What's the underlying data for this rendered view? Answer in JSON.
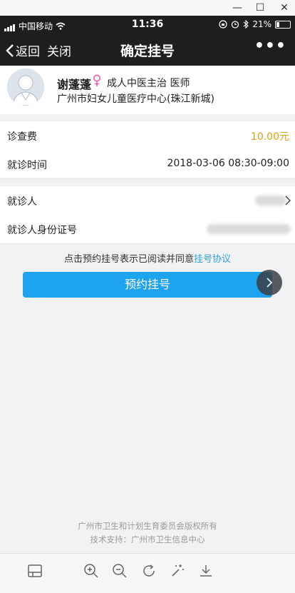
{
  "window_controls": {
    "minimize": "—",
    "maximize": "☐",
    "close": "✕"
  },
  "statusbar": {
    "carrier": "中国移动",
    "time": "11:36",
    "battery": "21%"
  },
  "navbar": {
    "back_label": "返回",
    "close_label": "关闭",
    "title": "确定挂号",
    "more_label": "•••"
  },
  "doctor": {
    "name": "谢蓬蓬",
    "gender_symbol": "♀",
    "title": "成人中医主治  医师",
    "hospital": "广州市妇女儿童医疗中心(珠江新城)"
  },
  "rows": {
    "fee_label": "诊查费",
    "fee_value": "10.00元",
    "time_label": "就诊时间",
    "time_value": "2018-03-06    08:30-09:00",
    "patient_label": "就诊人",
    "patient_id_label": "就诊人身份证号"
  },
  "agreement": {
    "prefix": "点击预约挂号表示已阅读并同意",
    "link": "挂号协议"
  },
  "button": {
    "label": "预约挂号"
  },
  "footer": {
    "line1": "广州市卫生和计划生育委员会版权所有",
    "line2": "技术支持：广州市卫生信息中心"
  },
  "colors": {
    "accent": "#1ea3ee",
    "fee": "#d9a214",
    "link": "#2fa3d7",
    "navbar": "#1e1e1e"
  }
}
